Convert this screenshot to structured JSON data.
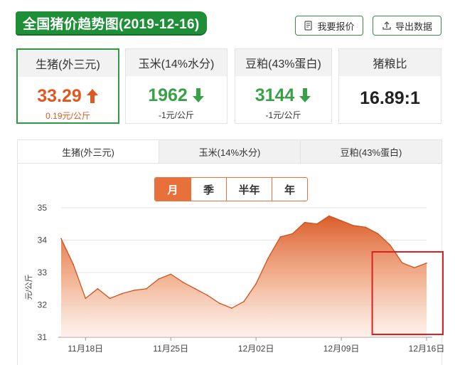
{
  "header": {
    "title": "全国猪价趋势图(2019-12-16)",
    "report_label": "我要报价",
    "export_label": "导出数据"
  },
  "cards": {
    "pig": {
      "label": "生猪(外三元)",
      "value": "33.29",
      "change": "0.19元/公斤",
      "trend": "up"
    },
    "corn": {
      "label": "玉米(14%水分)",
      "value": "1962",
      "change": "-1元/公斤",
      "trend": "down"
    },
    "soy": {
      "label": "豆粕(43%蛋白)",
      "value": "3144",
      "change": "-1元/公斤",
      "trend": "down"
    },
    "ratio": {
      "label": "猪粮比",
      "value": "16.89:1"
    }
  },
  "tabs": [
    "生猪(外三元)",
    "玉米(14%水分)",
    "豆粕(43%蛋白)"
  ],
  "periods": [
    "月",
    "季",
    "半年",
    "年"
  ],
  "colors": {
    "brand_green": "#1e8f36",
    "accent_orange": "#e8703a",
    "highlight_red": "#e02020"
  },
  "chart_data": {
    "type": "area",
    "ylabel": "元/公斤",
    "ylim": [
      31,
      35
    ],
    "yticks": [
      31,
      32,
      33,
      34,
      35
    ],
    "xtick_labels": [
      "11月18日",
      "11月25日",
      "12月02日",
      "12月09日",
      "12月16日"
    ],
    "xtick_index": [
      2,
      9,
      16,
      23,
      30
    ],
    "x": [
      "11月16日",
      "11月17日",
      "11月18日",
      "11月19日",
      "11月20日",
      "11月21日",
      "11月22日",
      "11月23日",
      "11月24日",
      "11月25日",
      "11月26日",
      "11月27日",
      "11月28日",
      "11月29日",
      "11月30日",
      "12月01日",
      "12月02日",
      "12月03日",
      "12月04日",
      "12月05日",
      "12月06日",
      "12月07日",
      "12月08日",
      "12月09日",
      "12月10日",
      "12月11日",
      "12月12日",
      "12月13日",
      "12月14日",
      "12月15日",
      "12月16日"
    ],
    "series": [
      {
        "values": [
          34.05,
          33.25,
          32.2,
          32.5,
          32.2,
          32.35,
          32.45,
          32.5,
          32.8,
          32.95,
          32.7,
          32.5,
          32.3,
          32.05,
          31.9,
          32.1,
          32.65,
          33.45,
          34.1,
          34.2,
          34.55,
          34.5,
          34.75,
          34.6,
          34.45,
          34.4,
          34.2,
          33.85,
          33.3,
          33.15,
          33.29
        ]
      }
    ],
    "highlight_range": [
      "12月13日",
      "12月16日"
    ]
  }
}
